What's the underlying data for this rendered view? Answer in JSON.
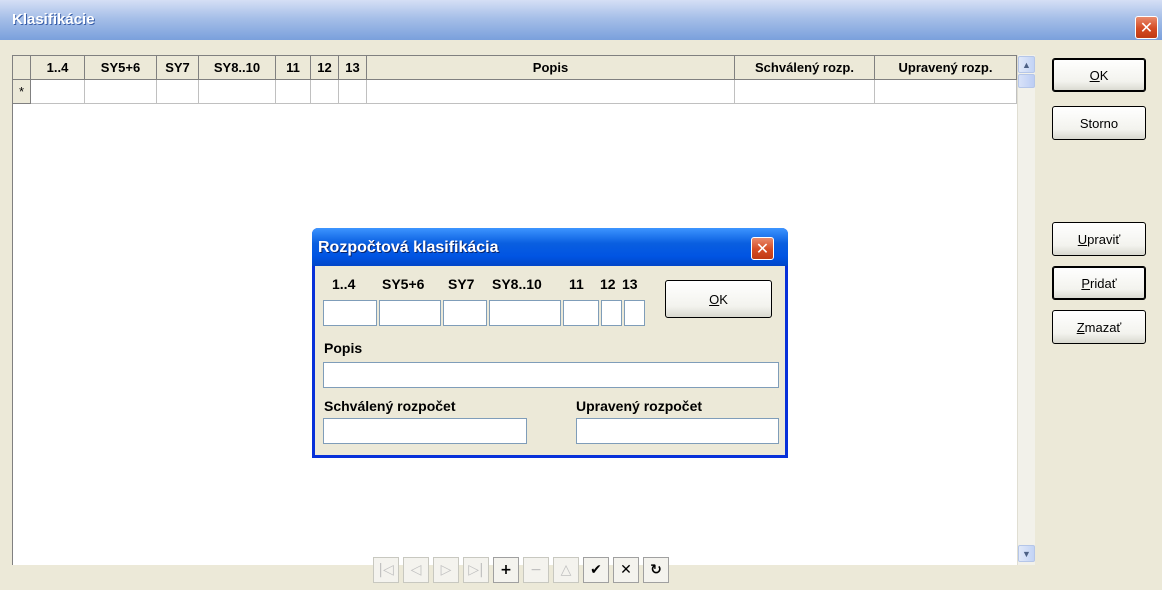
{
  "main_window": {
    "title": "Klasifikácie",
    "close_glyph": "✕"
  },
  "grid": {
    "columns": [
      {
        "label": ""
      },
      {
        "label": "1..4"
      },
      {
        "label": "SY5+6"
      },
      {
        "label": "SY7"
      },
      {
        "label": "SY8..10"
      },
      {
        "label": "11"
      },
      {
        "label": "12"
      },
      {
        "label": "13"
      },
      {
        "label": "Popis"
      },
      {
        "label": "Schválený rozp."
      },
      {
        "label": "Upravený rozp."
      }
    ],
    "new_row_indicator": "*"
  },
  "scrollbar": {
    "up_glyph": "▲",
    "down_glyph": "▼"
  },
  "buttons": {
    "ok": {
      "accel": "O",
      "rest": "K"
    },
    "storno": "Storno",
    "upravit": {
      "accel": "U",
      "rest": "praviť"
    },
    "pridat": {
      "accel": "P",
      "rest": "ridať"
    },
    "zmazat": {
      "accel": "Z",
      "rest": "mazať"
    }
  },
  "navigator": {
    "first": "|◁",
    "prior": "◁",
    "next": "▷",
    "last": "▷|",
    "insert": "+",
    "delete": "−",
    "edit": "△",
    "post": "✔",
    "cancel": "✕",
    "refresh": "↻"
  },
  "dialog": {
    "title": "Rozpočtová klasifikácia",
    "close_glyph": "✕",
    "labels": {
      "c1": "1..4",
      "c2": "SY5+6",
      "c3": "SY7",
      "c4": "SY8..10",
      "c5": "11",
      "c6": "12",
      "c7": "13",
      "popis": "Popis",
      "schvaleny": "Schválený rozpočet",
      "upraveny": "Upravený rozpočet"
    },
    "ok": {
      "accel": "O",
      "rest": "K"
    },
    "values": {
      "c1": "",
      "c2": "",
      "c3": "",
      "c4": "",
      "c5": "",
      "c6": "",
      "c7": "",
      "popis": "",
      "schvaleny": "",
      "upraveny": ""
    }
  }
}
